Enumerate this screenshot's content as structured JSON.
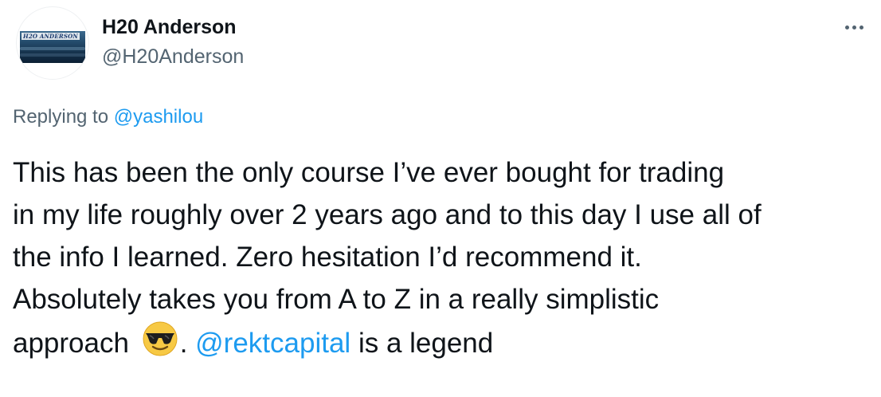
{
  "tweet": {
    "avatar": {
      "logo_text": "H2O ANDERSON",
      "icon": "avatar-ocean-logo"
    },
    "display_name": "H20 Anderson",
    "handle": "@H20Anderson",
    "more_icon": "more-horizontal-icon",
    "replying": {
      "prefix": "Replying to",
      "mention": "@yashilou"
    },
    "body": {
      "line1": "This has been the only course I’ve ever bought for trading",
      "line2": "in my life roughly over 2 years ago and to this day I use all of",
      "line3": "the info I learned. Zero hesitation I’d recommend it.",
      "line4": "Absolutely takes you from A to Z in a really simplistic",
      "line5_start": "approach",
      "emoji": "smiling-face-with-sunglasses",
      "line5_dot": ".",
      "line5_mention": "@rektcapital",
      "line5_end": "is a legend"
    },
    "colors": {
      "link": "#1d9bf0",
      "secondary_text": "#536471",
      "primary_text": "#0f1419",
      "background": "#ffffff"
    }
  }
}
